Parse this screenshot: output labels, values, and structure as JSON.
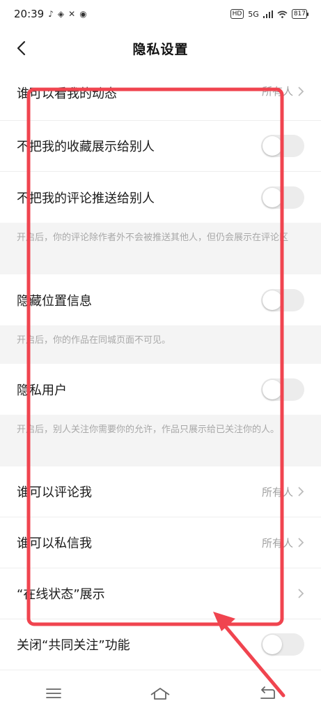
{
  "status_bar": {
    "time": "20:39",
    "network": "5G",
    "battery": "817"
  },
  "nav": {
    "title": "隐私设置"
  },
  "rows": {
    "who_can_view": {
      "label": "谁可以看我的动态",
      "value": "所有人"
    },
    "hide_favorites": {
      "label": "不把我的收藏展示给别人"
    },
    "hide_comments": {
      "label": "不把我的评论推送给别人"
    },
    "comments_note": "开启后，你的评论除作者外不会被推送其他人，但仍会展示在评论区",
    "hide_location": {
      "label": "隐藏位置信息"
    },
    "location_note": "开启后，你的作品在同城页面不可见。",
    "private_user": {
      "label": "隐私用户"
    },
    "private_note": "开启后，别人关注你需要你的允许，作品只展示给已关注你的人。",
    "who_can_comment": {
      "label": "谁可以评论我",
      "value": "所有人"
    },
    "who_can_message": {
      "label": "谁可以私信我",
      "value": "所有人"
    },
    "online_status": {
      "label": "“在线状态”展示"
    },
    "mutual_follow": {
      "label": "关闭“共同关注”功能"
    }
  },
  "colors": {
    "annotation": "#f0444f",
    "toggle_off": "#ececec",
    "note_bg": "#f4f4f4"
  }
}
